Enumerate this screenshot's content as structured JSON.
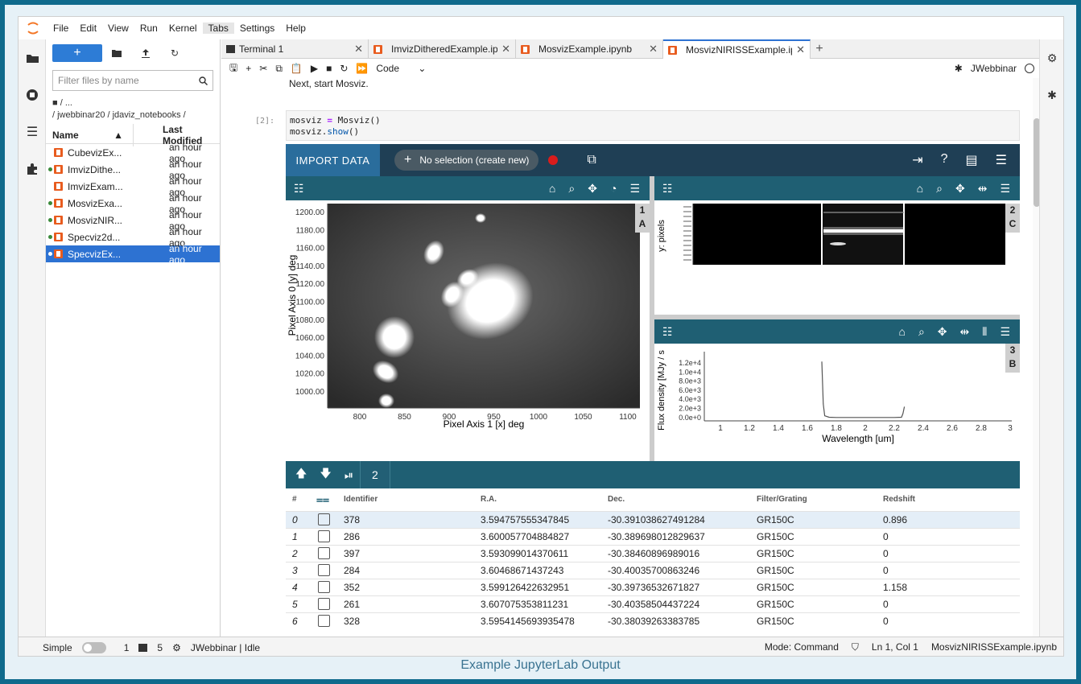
{
  "caption": "Example JupyterLab Output",
  "menubar": {
    "items": [
      "File",
      "Edit",
      "View",
      "Run",
      "Kernel",
      "Tabs",
      "Settings",
      "Help"
    ]
  },
  "filebrowser": {
    "new_label": "+",
    "filter_placeholder": "Filter files by name",
    "path_root": "■ / ...",
    "path": "/ jwebbinar20 / jdaviz_notebooks /",
    "col_name": "Name",
    "col_modified": "Last Modified",
    "files": [
      {
        "name": "CubevizEx...",
        "modified": "an hour ago",
        "running": false
      },
      {
        "name": "ImvizDithe...",
        "modified": "an hour ago",
        "running": true
      },
      {
        "name": "ImvizExam...",
        "modified": "an hour ago",
        "running": false
      },
      {
        "name": "MosvizExa...",
        "modified": "an hour ago",
        "running": true
      },
      {
        "name": "MosvizNIR...",
        "modified": "an hour ago",
        "running": true
      },
      {
        "name": "Specviz2d...",
        "modified": "an hour ago",
        "running": true
      },
      {
        "name": "SpecvizEx...",
        "modified": "an hour ago",
        "running": true
      }
    ]
  },
  "tabs": [
    {
      "label": "Terminal 1",
      "type": "terminal"
    },
    {
      "label": "ImvizDitheredExample.ipyn",
      "type": "notebook"
    },
    {
      "label": "MosvizExample.ipynb",
      "type": "notebook"
    },
    {
      "label": "MosvizNIRISSExample.ipyn",
      "type": "notebook",
      "active": true
    }
  ],
  "nbtoolbar": {
    "cell_type": "Code",
    "kernel": "JWebbinar"
  },
  "notebook": {
    "markdown": "Next, start Mosviz.",
    "prompt": "[2]:",
    "code_line1_var": "mosviz",
    "code_line1_op": " = ",
    "code_line1_call": "Mosviz()",
    "code_line2_obj": "mosviz.",
    "code_line2_call": "show",
    "code_line2_end": "()"
  },
  "mosviz": {
    "import_label": "IMPORT DATA",
    "selection_label": "No selection (create new)",
    "viewer1_tab": [
      "1",
      "A"
    ],
    "viewer2_tab": [
      "2",
      "C"
    ],
    "viewer3_tab": [
      "3",
      "B"
    ],
    "image": {
      "xlabel": "Pixel Axis 1 [x] deg",
      "ylabel": "Pixel Axis 0 [y] deg",
      "xticks": [
        "800",
        "850",
        "900",
        "950",
        "1000",
        "1050",
        "1100"
      ],
      "yticks": [
        "1200.00",
        "1180.00",
        "1160.00",
        "1140.00",
        "1120.00",
        "1100.00",
        "1080.00",
        "1060.00",
        "1040.00",
        "1020.00",
        "1000.00"
      ]
    },
    "spec2d": {
      "ylabel": "y: pixels"
    },
    "spec1d": {
      "xlabel": "Wavelength [um]",
      "ylabel": "Flux density [MJy / s",
      "xticks": [
        "1",
        "1.2",
        "1.4",
        "1.6",
        "1.8",
        "2",
        "2.2",
        "2.4",
        "2.6",
        "2.8",
        "3"
      ],
      "yticks": [
        "1.2e+4",
        "1.0e+4",
        "8.0e+3",
        "6.0e+3",
        "4.0e+3",
        "2.0e+3",
        "0.0e+0"
      ]
    },
    "table": {
      "page": "2",
      "columns": [
        "#",
        "",
        "Identifier",
        "R.A.",
        "Dec.",
        "Filter/Grating",
        "Redshift"
      ],
      "rows": [
        {
          "idx": "0",
          "id": "378",
          "ra": "3.594757555347845",
          "dec": "-30.391038627491284",
          "fg": "GR150C",
          "z": "0.896"
        },
        {
          "idx": "1",
          "id": "286",
          "ra": "3.600057704884827",
          "dec": "-30.389698012829637",
          "fg": "GR150C",
          "z": "0"
        },
        {
          "idx": "2",
          "id": "397",
          "ra": "3.593099014370611",
          "dec": "-30.38460896989016",
          "fg": "GR150C",
          "z": "0"
        },
        {
          "idx": "3",
          "id": "284",
          "ra": "3.60468671437243",
          "dec": "-30.40035700863246",
          "fg": "GR150C",
          "z": "0"
        },
        {
          "idx": "4",
          "id": "352",
          "ra": "3.599126422632951",
          "dec": "-30.39736532671827",
          "fg": "GR150C",
          "z": "1.158"
        },
        {
          "idx": "5",
          "id": "261",
          "ra": "3.607075353811231",
          "dec": "-30.40358504437224",
          "fg": "GR150C",
          "z": "0"
        },
        {
          "idx": "6",
          "id": "328",
          "ra": "3.5954145693935478",
          "dec": "-30.38039263383785",
          "fg": "GR150C",
          "z": "0"
        }
      ]
    }
  },
  "statusbar": {
    "mode_label": "Simple",
    "terminals": "1",
    "kernels": "5",
    "kernel_status": "JWebbinar | Idle",
    "mode": "Mode: Command",
    "cursor": "Ln 1, Col 1",
    "file": "MosvizNIRISSExample.ipynb"
  }
}
